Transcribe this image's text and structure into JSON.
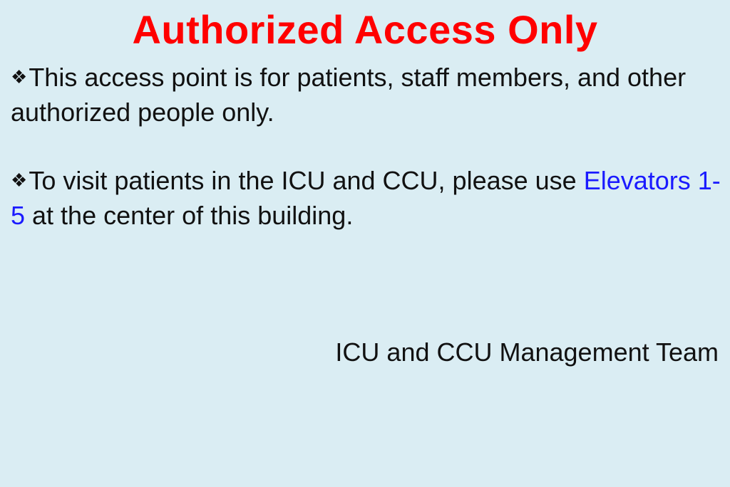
{
  "sign": {
    "title": "Authorized Access Only",
    "title_color": "#ff0000",
    "bullet_icon": "four-diamond-bullet",
    "paragraph_1": {
      "bullet": "❖",
      "text": "This access point is for patients, staff members, and other authorized people only."
    },
    "paragraph_2": {
      "bullet": "❖",
      "text_before": "To visit patients in the ICU and CCU, please use ",
      "highlight": "Elevators 1-5",
      "highlight_color": "#1a1aff",
      "text_after": " at the center of this building."
    },
    "signature": "ICU and CCU Management Team",
    "background_color": "#daedf3"
  }
}
